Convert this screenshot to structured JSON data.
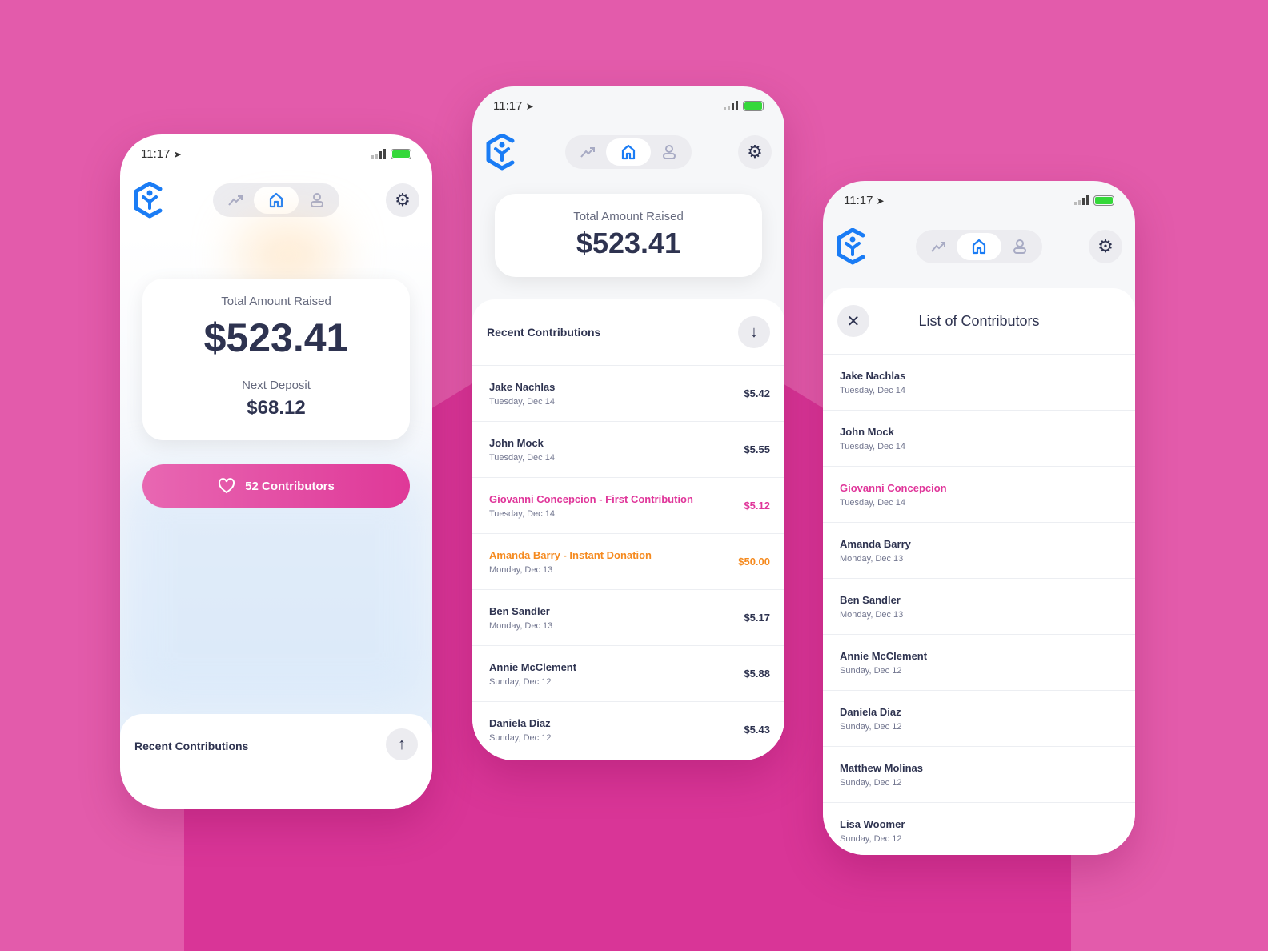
{
  "colors": {
    "pink": "#e0369a",
    "orange": "#f58a1f",
    "blue": "#1a7cf5",
    "text": "#2e3350"
  },
  "status": {
    "time": "11:17"
  },
  "nav": {
    "tabs": [
      "trend-icon",
      "home-icon",
      "user-icon"
    ],
    "active": "home"
  },
  "home": {
    "total_label": "Total Amount Raised",
    "total": "$523.41",
    "next_label": "Next Deposit",
    "next": "$68.12",
    "contributors_button": "52 Contributors",
    "recent_label": "Recent Contributions"
  },
  "recent": {
    "total_label": "Total Amount Raised",
    "total": "$523.41",
    "title": "Recent Contributions",
    "items": [
      {
        "name": "Jake Nachlas",
        "date": "Tuesday, Dec 14",
        "amount": "$5.42",
        "highlight": ""
      },
      {
        "name": "John Mock",
        "date": "Tuesday, Dec 14",
        "amount": "$5.55",
        "highlight": ""
      },
      {
        "name": "Giovanni Concepcion - First Contribution",
        "date": "Tuesday, Dec 14",
        "amount": "$5.12",
        "highlight": "pink"
      },
      {
        "name": "Amanda Barry - Instant Donation",
        "date": "Monday, Dec 13",
        "amount": "$50.00",
        "highlight": "orange"
      },
      {
        "name": "Ben Sandler",
        "date": "Monday, Dec 13",
        "amount": "$5.17",
        "highlight": ""
      },
      {
        "name": "Annie McClement",
        "date": "Sunday, Dec 12",
        "amount": "$5.88",
        "highlight": ""
      },
      {
        "name": "Daniela Diaz",
        "date": "Sunday, Dec 12",
        "amount": "$5.43",
        "highlight": ""
      }
    ]
  },
  "contributors": {
    "title": "List of Contributors",
    "items": [
      {
        "name": "Jake Nachlas",
        "date": "Tuesday, Dec 14",
        "highlight": ""
      },
      {
        "name": "John Mock",
        "date": "Tuesday, Dec 14",
        "highlight": ""
      },
      {
        "name": "Giovanni Concepcion",
        "date": "Tuesday, Dec 14",
        "highlight": "pink"
      },
      {
        "name": "Amanda Barry",
        "date": "Monday, Dec 13",
        "highlight": ""
      },
      {
        "name": "Ben Sandler",
        "date": "Monday, Dec 13",
        "highlight": ""
      },
      {
        "name": "Annie McClement",
        "date": "Sunday, Dec 12",
        "highlight": ""
      },
      {
        "name": "Daniela Diaz",
        "date": "Sunday, Dec 12",
        "highlight": ""
      },
      {
        "name": "Matthew Molinas",
        "date": "Sunday, Dec 12",
        "highlight": ""
      },
      {
        "name": "Lisa Woomer",
        "date": "Sunday, Dec 12",
        "highlight": ""
      }
    ]
  }
}
